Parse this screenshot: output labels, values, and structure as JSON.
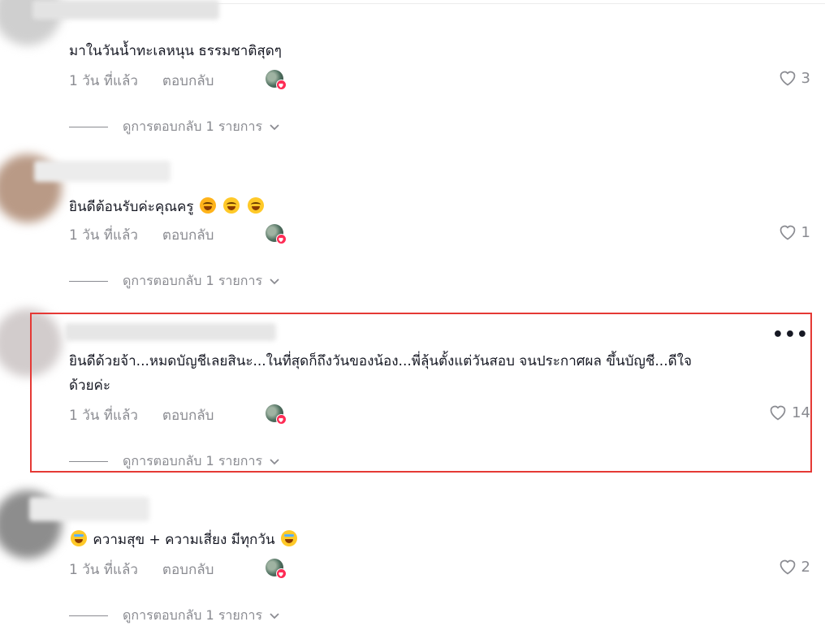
{
  "comments": [
    {
      "text": "มาในวันน้ำทะเลหนุน ธรรมชาติสุดๆ",
      "time": "1 วัน ที่แล้ว",
      "reply": "ตอบกลับ",
      "likes": "3",
      "view_replies": "ดูการตอบกลับ 1 รายการ",
      "emojis": []
    },
    {
      "text": "ยินดีต้อนรับค่ะคุณครู",
      "time": "1 วัน ที่แล้ว",
      "reply": "ตอบกลับ",
      "likes": "1",
      "view_replies": "ดูการตอบกลับ 1 รายการ",
      "emojis": [
        "smiling-face-with-hearts-emoji",
        "grinning-sweat-emoji",
        "grinning-sweat-emoji"
      ]
    },
    {
      "text_line1": "ยินดีด้วยจ้า...หมดบัญชีเลยสินะ...ในที่สุดก็ถึงวันของน้อง...พี่ลุ้นตั้งแต่วันสอบ จนประกาศผล ขึ้นบัญชี...ดีใจ",
      "text_line2": "ด้วยค่ะ",
      "time": "1 วัน ที่แล้ว",
      "reply": "ตอบกลับ",
      "likes": "14",
      "view_replies": "ดูการตอบกลับ 1 รายการ",
      "more_label": "•••",
      "highlighted": true
    },
    {
      "text_a": "ความสุข + ความเสี่ยง มีทุกวัน",
      "time": "1 วัน ที่แล้ว",
      "reply": "ตอบกลับ",
      "likes": "2",
      "view_replies": "ดูการตอบกลับ 1 รายการ",
      "emojis": [
        "tears-of-joy-emoji",
        "tears-of-joy-emoji"
      ]
    }
  ],
  "colors": {
    "text": "#161823",
    "muted": "#8a8b91",
    "heart_badge": "#fe2c55",
    "highlight_border": "#e53935"
  }
}
